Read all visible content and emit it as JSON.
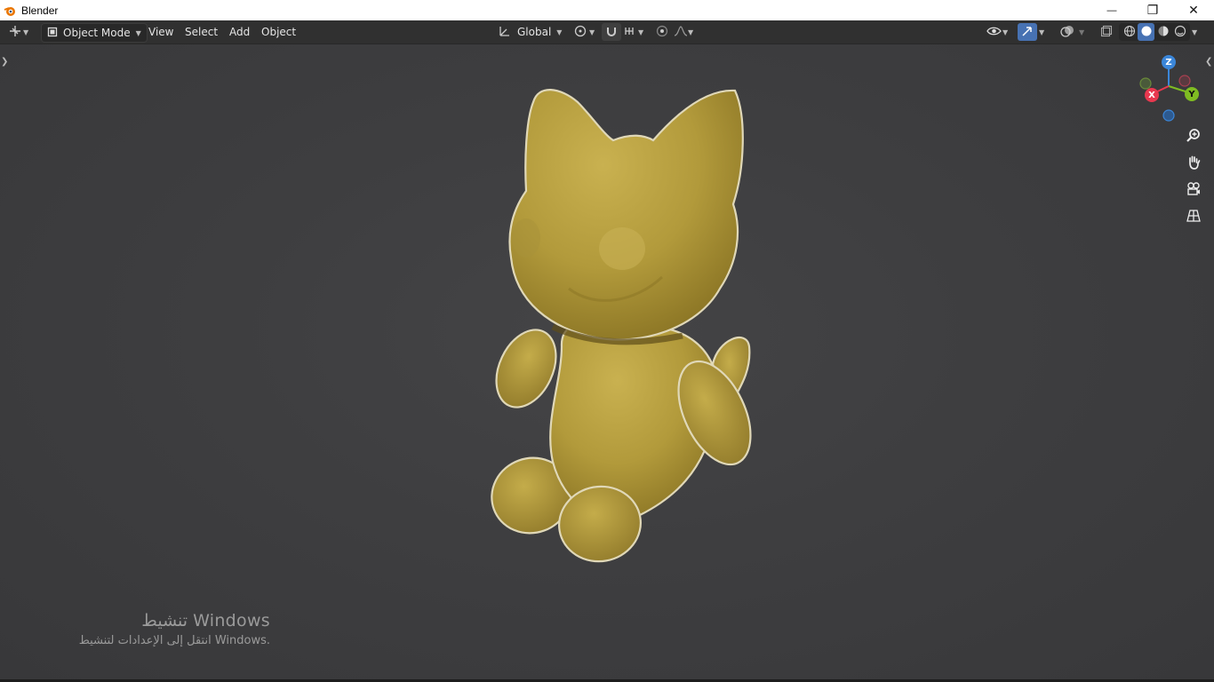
{
  "window": {
    "title": "Blender",
    "controls": {
      "minimize": "—",
      "restore": "❐",
      "close": "✕"
    }
  },
  "header": {
    "editor_type_icon": "move-gizmo-icon",
    "mode": "Object Mode",
    "menus": [
      "View",
      "Select",
      "Add",
      "Object"
    ],
    "transform_orientation": "Global",
    "pivot_icon": "pivot-point-icon",
    "snap_icon": "snap-magnet-icon",
    "snap_increment_icon": "snap-increment-icon",
    "proportional_icon": "proportional-edit-icon",
    "falloff_icon": "falloff-curve-icon",
    "visibility_icon": "eye-icon",
    "gizmo_toggle_icon": "gizmo-icon",
    "overlay_icon": "overlay-icon",
    "xray_icon": "xray-icon",
    "shading_modes": [
      "wireframe",
      "solid",
      "material-preview",
      "rendered"
    ],
    "active_shading": "solid"
  },
  "gizmo": {
    "axes": {
      "z": "Z",
      "y": "Y",
      "x": "X"
    },
    "colors": {
      "x": "#e8384f",
      "y": "#7fbc22",
      "z": "#3b86d9"
    }
  },
  "nav_tools": [
    "zoom-icon",
    "hand-pan-icon",
    "camera-view-icon",
    "perspective-grid-icon"
  ],
  "model": {
    "name": "cat-figurine",
    "color": "#b8a140"
  },
  "activation": {
    "title": "تنشيط Windows",
    "subtitle": "انتقل إلى الإعدادات لتنشيط Windows."
  },
  "colors": {
    "header_bg": "#303030",
    "viewport_bg": "#3d3d3d",
    "accent": "#4772b3"
  }
}
